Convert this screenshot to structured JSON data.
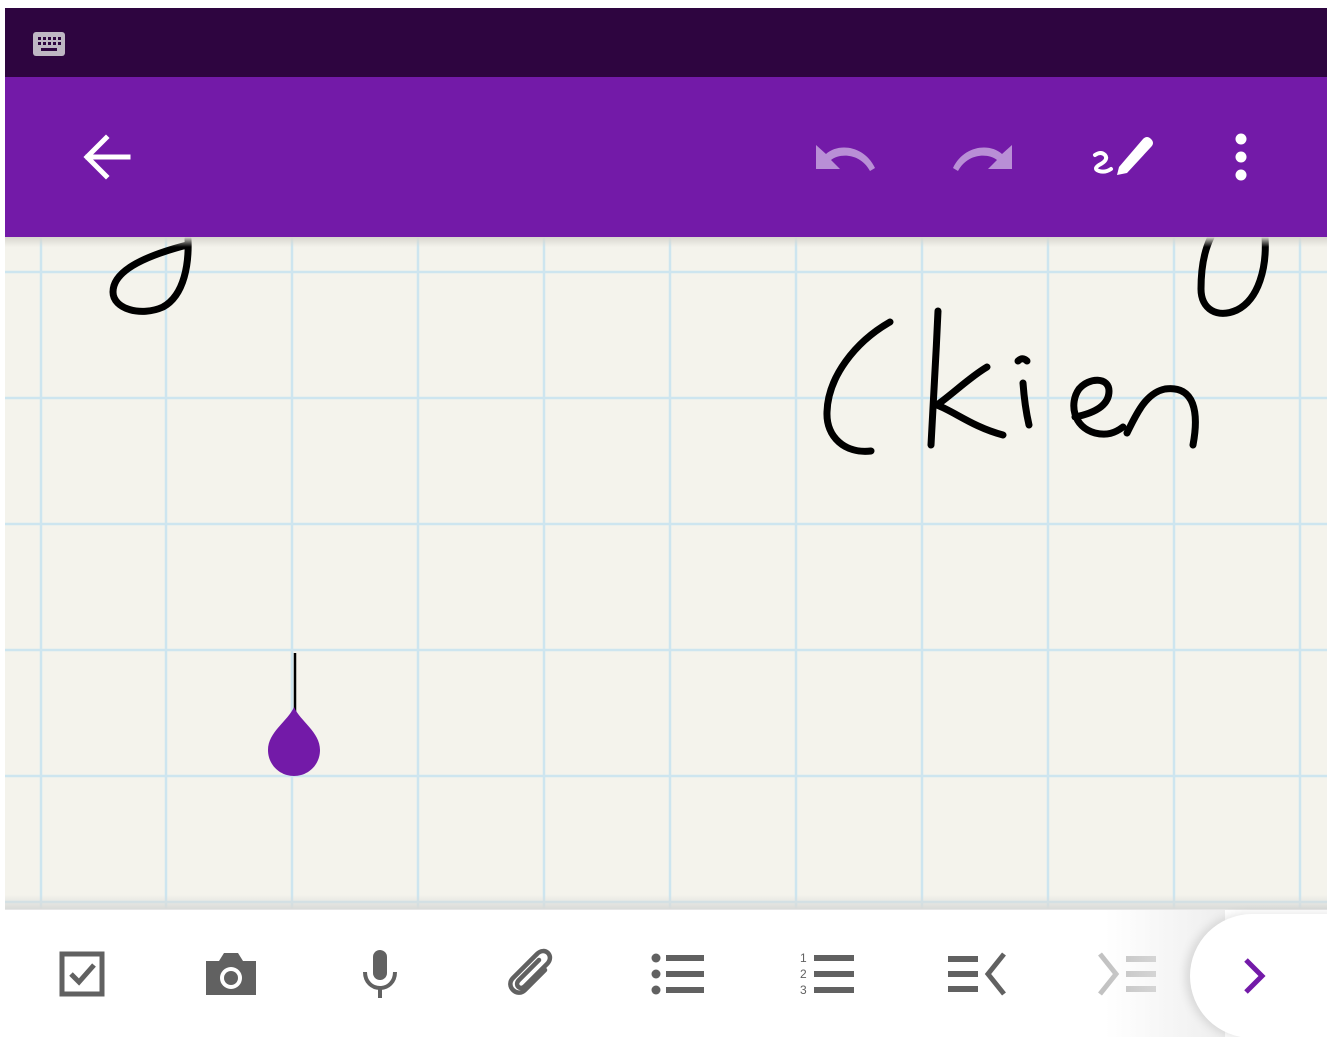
{
  "colors": {
    "status_bar": "#2e0540",
    "app_bar": "#731aa8",
    "accent": "#731aa8",
    "canvas_bg": "#f4f3ec",
    "grid_line": "#cde5ef",
    "ink": "#000000",
    "disabled_icon": "#b98fd6",
    "toolbar_icon": "#616161"
  },
  "status_bar": {
    "icons": [
      "keyboard-icon"
    ]
  },
  "app_bar": {
    "icons": [
      "back-arrow-icon",
      "undo-icon",
      "redo-icon",
      "pen-edit-icon",
      "more-vert-icon"
    ],
    "undo_enabled": false,
    "redo_enabled": false
  },
  "canvas": {
    "paper": "grid",
    "handwriting_text": "(kies",
    "cursor": "text-insertion-handle"
  },
  "toolbar": {
    "tools": [
      {
        "name": "checkbox-icon"
      },
      {
        "name": "camera-icon"
      },
      {
        "name": "microphone-icon"
      },
      {
        "name": "attachment-icon"
      },
      {
        "name": "bulleted-list-icon"
      },
      {
        "name": "numbered-list-icon"
      },
      {
        "name": "decrease-indent-icon"
      },
      {
        "name": "increase-indent-icon"
      }
    ],
    "expand_icon": "chevron-right-icon",
    "numbered_list_digits": [
      "1",
      "2",
      "3"
    ]
  }
}
